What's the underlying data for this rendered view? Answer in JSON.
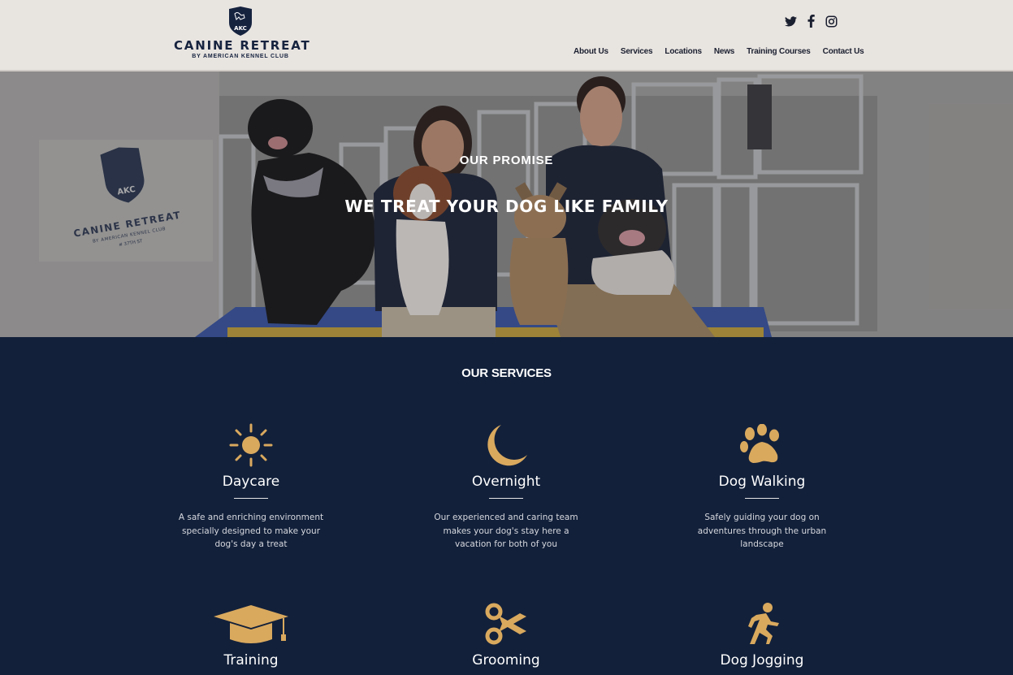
{
  "header": {
    "brand": "CANINE RETREAT",
    "brand_sub": "BY AMERICAN KENNEL CLUB",
    "shield_text": "AKC",
    "social": [
      "twitter-icon",
      "facebook-icon",
      "instagram-icon"
    ],
    "nav": [
      "About Us",
      "Services",
      "Locations",
      "News",
      "Training Courses",
      "Contact Us"
    ]
  },
  "hero": {
    "eyebrow": "OUR PROMISE",
    "headline": "WE TREAT YOUR DOG LIKE FAMILY",
    "wall_logo": {
      "shield_text": "AKC",
      "brand": "CANINE RETREAT",
      "brand_sub": "BY AMERICAN KENNEL CLUB",
      "street": "# 37TH ST"
    }
  },
  "services": {
    "title": "OUR SERVICES",
    "items": [
      {
        "name": "Daycare",
        "icon": "sun-icon",
        "desc": "A safe and enriching environment specially designed to make your dog's day a treat"
      },
      {
        "name": "Overnight",
        "icon": "moon-icon",
        "desc": "Our experienced and caring team makes your dog's stay here a vacation for both of you"
      },
      {
        "name": "Dog Walking",
        "icon": "paw-icon",
        "desc": "Safely guiding your dog on adventures through the urban landscape"
      },
      {
        "name": "Training",
        "icon": "graduation-cap-icon",
        "desc": ""
      },
      {
        "name": "Grooming",
        "icon": "scissors-icon",
        "desc": ""
      },
      {
        "name": "Dog Jogging",
        "icon": "runner-icon",
        "desc": ""
      }
    ]
  },
  "colors": {
    "navy": "#12203a",
    "gold": "#d9a95e",
    "header_bg": "#e8e4e0"
  }
}
